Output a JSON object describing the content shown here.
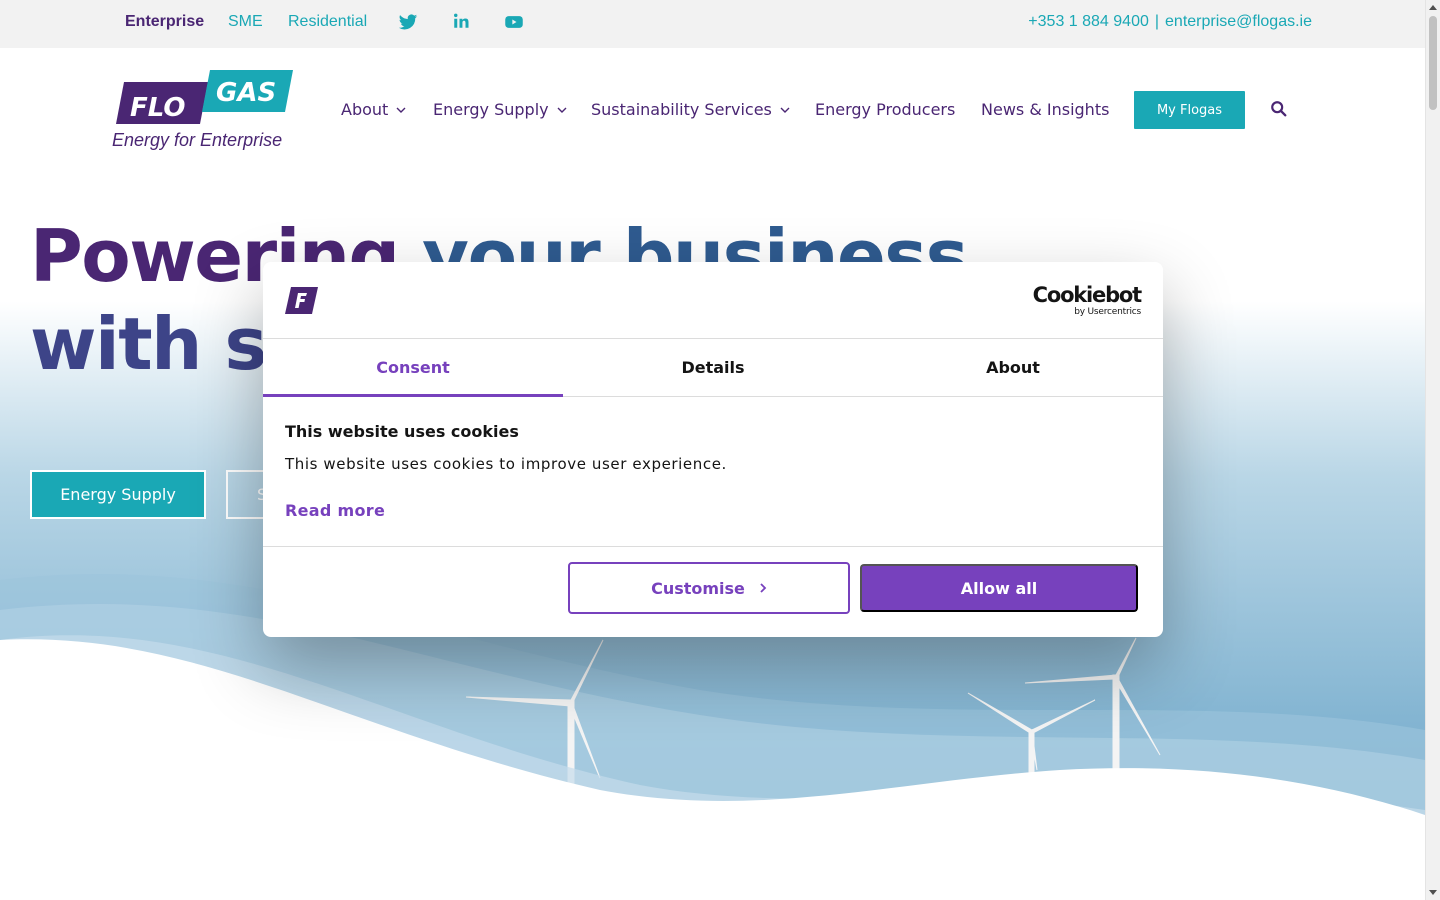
{
  "topbar": {
    "segments": [
      "Enterprise",
      "SME",
      "Residential"
    ],
    "phone": "+353 1 884 9400",
    "separator": "|",
    "email": "enterprise@flogas.ie",
    "social_icons": [
      "twitter-icon",
      "linkedin-icon",
      "youtube-icon"
    ]
  },
  "header": {
    "logo": {
      "flo": "FLO",
      "gas": "GAS",
      "tagline": "Energy for Enterprise"
    },
    "nav": [
      {
        "label": "About",
        "has_dropdown": true
      },
      {
        "label": "Energy Supply",
        "has_dropdown": true
      },
      {
        "label": "Sustainability Services",
        "has_dropdown": true
      },
      {
        "label": "Energy Producers",
        "has_dropdown": false
      },
      {
        "label": "News & Insights",
        "has_dropdown": false
      }
    ],
    "my_flogas": "My Flogas",
    "search_icon": "search-icon"
  },
  "hero": {
    "title_line1_a": "Powering ",
    "title_line1_b": "your business",
    "title_line2_a": "with su",
    "primary_button": "Energy Supply",
    "secondary_button": "S"
  },
  "cookie_dialog": {
    "brand": "Cookiebot",
    "brand_sub": "by Usercentrics",
    "tabs": [
      {
        "label": "Consent",
        "active": true
      },
      {
        "label": "Details",
        "active": false
      },
      {
        "label": "About",
        "active": false
      }
    ],
    "heading": "This website uses cookies",
    "body": "This website uses cookies to improve user experience.",
    "read_more": "Read more",
    "customise_label": "Customise",
    "allow_all_label": "Allow all"
  },
  "colors": {
    "brand_purple": "#4a2673",
    "brand_teal": "#1aa8b5",
    "cookie_accent": "#7741bd"
  }
}
